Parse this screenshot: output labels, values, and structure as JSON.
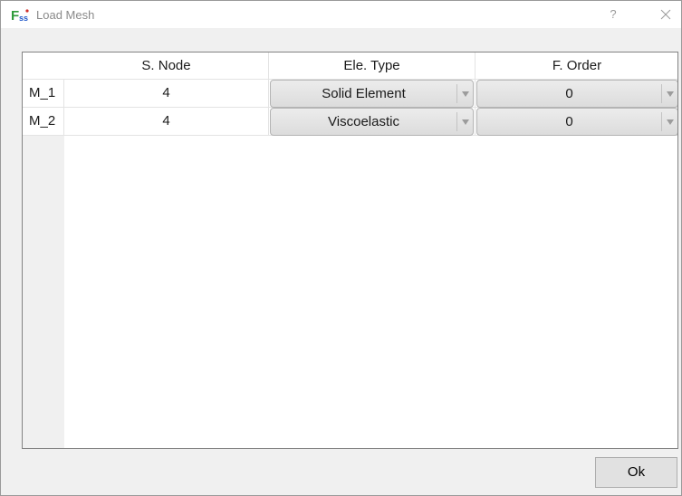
{
  "window": {
    "title": "Load Mesh",
    "help_label": "?",
    "icon_letters": "F",
    "icon_sub": "ss"
  },
  "table": {
    "columns": [
      "S. Node",
      "Ele. Type",
      "F. Order"
    ],
    "rows": [
      {
        "header": "M_1",
        "s_node": "4",
        "ele_type": "Solid Element",
        "f_order": "0"
      },
      {
        "header": "M_2",
        "s_node": "4",
        "ele_type": "Viscoelastic",
        "f_order": "0"
      }
    ]
  },
  "buttons": {
    "ok_label": "Ok"
  },
  "icons": {
    "app": "app-logo-icon",
    "help": "help-icon",
    "close": "close-icon",
    "dropdown": "dropdown-arrow-icon"
  },
  "colors": {
    "title_text": "#8a8a8a",
    "dialog_background": "#f0f0f0",
    "combo_background": "#e4e4e4",
    "icon_green": "#2e9b3a",
    "icon_blue": "#1f57c9",
    "icon_red": "#d2302b"
  }
}
